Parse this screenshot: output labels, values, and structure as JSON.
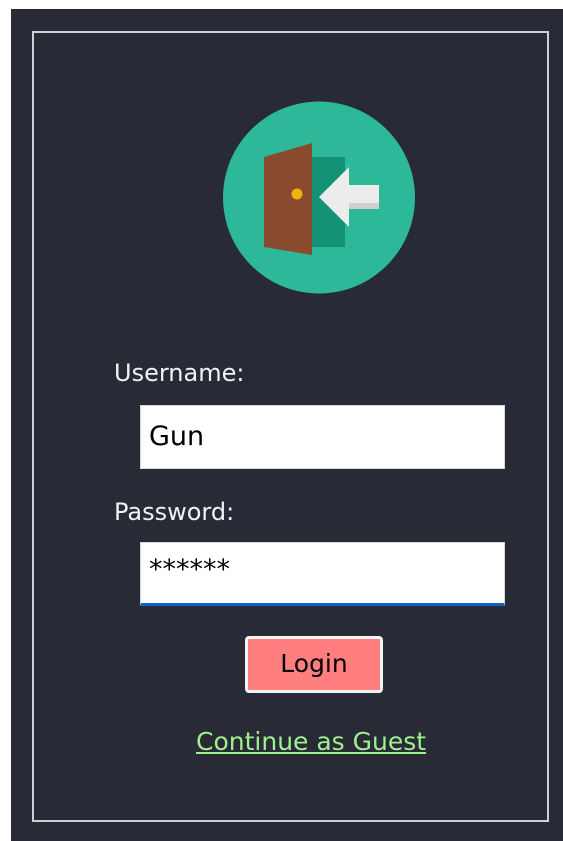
{
  "form": {
    "username_label": "Username:",
    "username_value": "Gun",
    "password_label": "Password:",
    "password_value": "******",
    "login_label": "Login",
    "guest_link": "Continue as Guest"
  },
  "icons": {
    "logo": "enter-door-icon"
  },
  "colors": {
    "background": "#282a36",
    "logo_circle": "#2db89a",
    "door": "#8a4a2e",
    "login_button": "#ff7f7f",
    "guest_link": "#9ff08f",
    "focus_underline": "#1062c8"
  }
}
